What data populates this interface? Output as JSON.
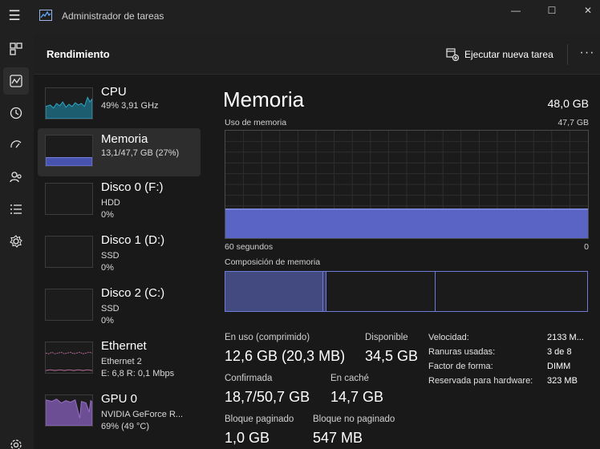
{
  "app": {
    "title": "Administrador de tareas"
  },
  "window_controls": {
    "minimize": "—",
    "maximize": "☐",
    "close": "✕"
  },
  "nav": [
    {
      "name": "processes-icon"
    },
    {
      "name": "performance-icon",
      "active": true
    },
    {
      "name": "app-history-icon"
    },
    {
      "name": "startup-apps-icon"
    },
    {
      "name": "users-icon"
    },
    {
      "name": "details-icon"
    },
    {
      "name": "services-icon"
    },
    {
      "name": "settings-icon"
    }
  ],
  "header": {
    "title": "Rendimiento",
    "run_task_label": "Ejecutar nueva tarea",
    "more_label": "···"
  },
  "devices": [
    {
      "name": "CPU",
      "sub1": "49% 3,91 GHz",
      "sub2": "",
      "color": "#2fa8c7",
      "fill": "#1c5d70"
    },
    {
      "name": "Memoria",
      "sub1": "13,1/47,7 GB (27%)",
      "sub2": "",
      "color": "#7c86e8",
      "fill": "#4853b0"
    },
    {
      "name": "Disco 0 (F:)",
      "sub1": "HDD",
      "sub2": "0%",
      "color": "#6ab04c"
    },
    {
      "name": "Disco 1 (D:)",
      "sub1": "SSD",
      "sub2": "0%",
      "color": "#6ab04c"
    },
    {
      "name": "Disco 2 (C:)",
      "sub1": "SSD",
      "sub2": "0%",
      "color": "#6ab04c"
    },
    {
      "name": "Ethernet",
      "sub1": "Ethernet 2",
      "sub2": "E: 6,8 R: 0,1 Mbps",
      "color": "#c26fa0"
    },
    {
      "name": "GPU 0",
      "sub1": "NVIDIA GeForce R...",
      "sub2": "69% (49 °C)",
      "color": "#9a6fc9",
      "fill": "#6c4e95"
    }
  ],
  "memory": {
    "title": "Memoria",
    "total": "48,0 GB",
    "usage_label": "Uso de memoria",
    "usage_max": "47,7 GB",
    "usage_percent": 27,
    "x_left": "60 segundos",
    "x_right": "0",
    "composition_label": "Composición de memoria",
    "composition": {
      "in_use_fraction": 0.27,
      "modified_fraction": 0.01,
      "standby_fraction": 0.3
    },
    "stats": {
      "in_use_label": "En uso (comprimido)",
      "in_use_value": "12,6 GB (20,3 MB)",
      "available_label": "Disponible",
      "available_value": "34,5 GB",
      "committed_label": "Confirmada",
      "committed_value": "18,7/50,7 GB",
      "cached_label": "En caché",
      "cached_value": "14,7 GB",
      "paged_label": "Bloque paginado",
      "paged_value": "1,0 GB",
      "nonpaged_label": "Bloque no paginado",
      "nonpaged_value": "547 MB"
    },
    "properties": [
      {
        "label": "Velocidad:",
        "value": "2133 M..."
      },
      {
        "label": "Ranuras usadas:",
        "value": "3 de 8"
      },
      {
        "label": "Factor de forma:",
        "value": "DIMM"
      },
      {
        "label": "Reservada para hardware:",
        "value": "323 MB"
      }
    ]
  }
}
